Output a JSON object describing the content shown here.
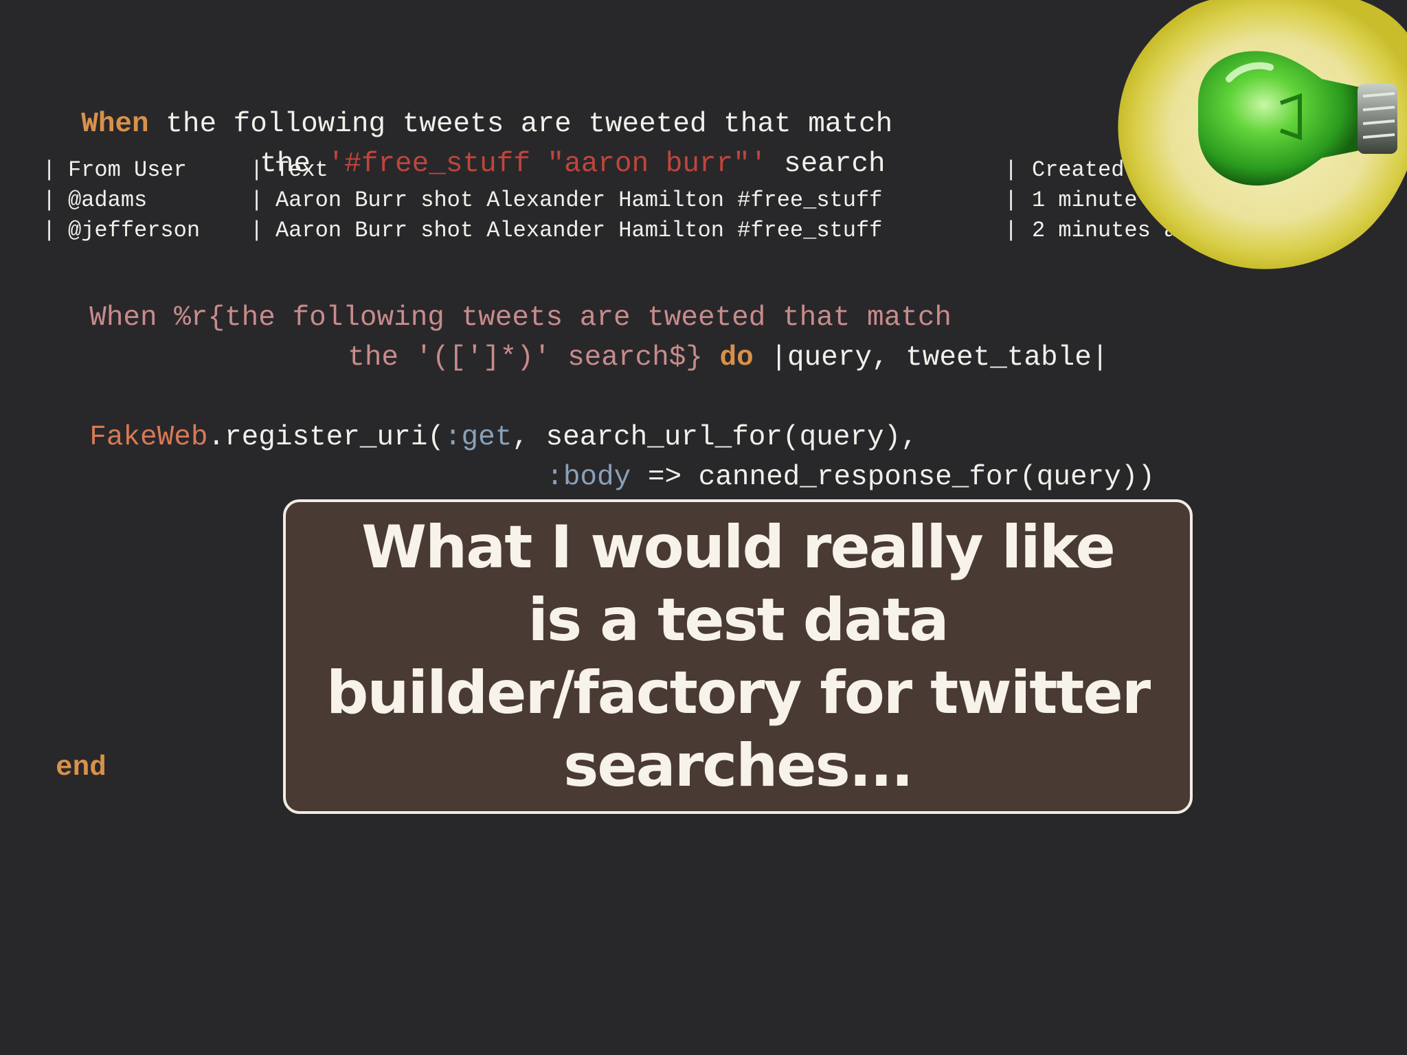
{
  "step": {
    "line1": {
      "kw": "When",
      "rest": " the following tweets are tweeted that match"
    },
    "line2": {
      "pre": "the ",
      "query": "'#free_stuff \"aaron burr\"'",
      "post": " search"
    }
  },
  "table": {
    "headers": [
      "From User",
      "Text",
      "Created At"
    ],
    "rows": [
      [
        "@adams",
        "Aaron Burr shot Alexander Hamilton #free_stuff",
        "1 minute ago"
      ],
      [
        "@jefferson",
        "Aaron Burr shot Alexander Hamilton #free_stuff",
        "2 minutes ago"
      ]
    ]
  },
  "code": {
    "l1_kw": "When",
    "l1_rx": " %r{the following tweets are tweeted that match",
    "l2_rx": "the '([']*)' search$}",
    "l2_do": "do",
    "l2_args": "|query, tweet_table|",
    "l3_cls": "FakeWeb",
    "l3_a": ".register_uri(",
    "l3_sym": ":get",
    "l3_b": ", search_url_for(query),",
    "l4_sym": ":body",
    "l4_b": " => canned_response_for(query))",
    "end": "end"
  },
  "callout": {
    "text": "What I would really like is a test data builder/factory for twitter searches..."
  },
  "colors": {
    "background": "#28282b",
    "keyword": "#d8914a",
    "string": "#c0453a",
    "regex": "#c98b8b",
    "symbol": "#8aa1b8",
    "callout_bg": "#4a3a34"
  },
  "decor": {
    "icon": "lightbulb-icon"
  }
}
